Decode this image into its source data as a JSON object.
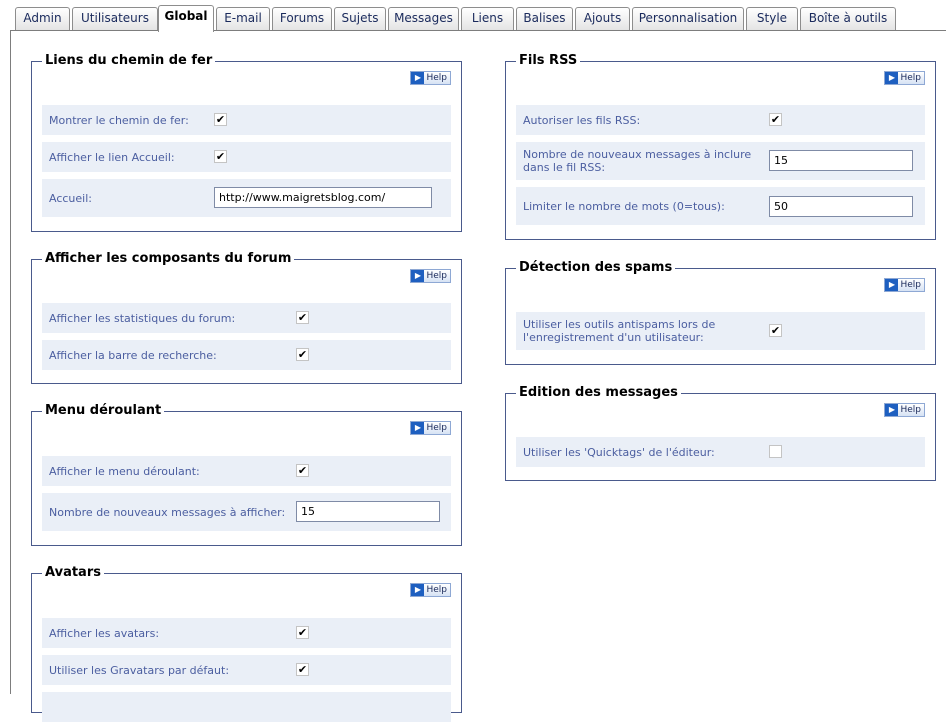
{
  "tabs": [
    {
      "label": "Admin"
    },
    {
      "label": "Utilisateurs"
    },
    {
      "label": "Global",
      "active": true
    },
    {
      "label": "E-mail"
    },
    {
      "label": "Forums"
    },
    {
      "label": "Sujets"
    },
    {
      "label": "Messages"
    },
    {
      "label": "Liens"
    },
    {
      "label": "Balises"
    },
    {
      "label": "Ajouts"
    },
    {
      "label": "Personnalisation"
    },
    {
      "label": "Style"
    },
    {
      "label": "Boîte à outils"
    }
  ],
  "help_label": "Help",
  "check_mark": "✔",
  "breadcrumbs": {
    "title": "Liens du chemin de fer",
    "show_label": "Montrer le chemin de fer:",
    "show_checked": true,
    "home_link_label": "Afficher le lien Accueil:",
    "home_link_checked": true,
    "home_label": "Accueil:",
    "home_value": "http://www.maigretsblog.com/"
  },
  "components": {
    "title": "Afficher les composants du forum",
    "stats_label": "Afficher les statistiques du forum:",
    "stats_checked": true,
    "search_label": "Afficher la barre de recherche:",
    "search_checked": true
  },
  "dropdown": {
    "title": "Menu déroulant",
    "show_label": "Afficher le menu déroulant:",
    "show_checked": true,
    "count_label": "Nombre de nouveaux messages à afficher:",
    "count_value": "15"
  },
  "avatars": {
    "title": "Avatars",
    "show_label": "Afficher les avatars:",
    "show_checked": true,
    "gravatar_label": "Utiliser les Gravatars par défaut:",
    "gravatar_checked": true
  },
  "rss": {
    "title": "Fils RSS",
    "allow_label": "Autoriser les fils RSS:",
    "allow_checked": true,
    "count_label": "Nombre de nouveaux messages à inclure dans le fil RSS:",
    "count_value": "15",
    "words_label": "Limiter le nombre de mots (0=tous):",
    "words_value": "50"
  },
  "spam": {
    "title": "Détection des spams",
    "tools_label": "Utiliser les outils antispams lors de l'enregistrement d'un utilisateur:",
    "tools_checked": true
  },
  "editing": {
    "title": "Edition des messages",
    "quicktags_label": "Utiliser les 'Quicktags' de l'éditeur:",
    "quicktags_checked": false
  }
}
